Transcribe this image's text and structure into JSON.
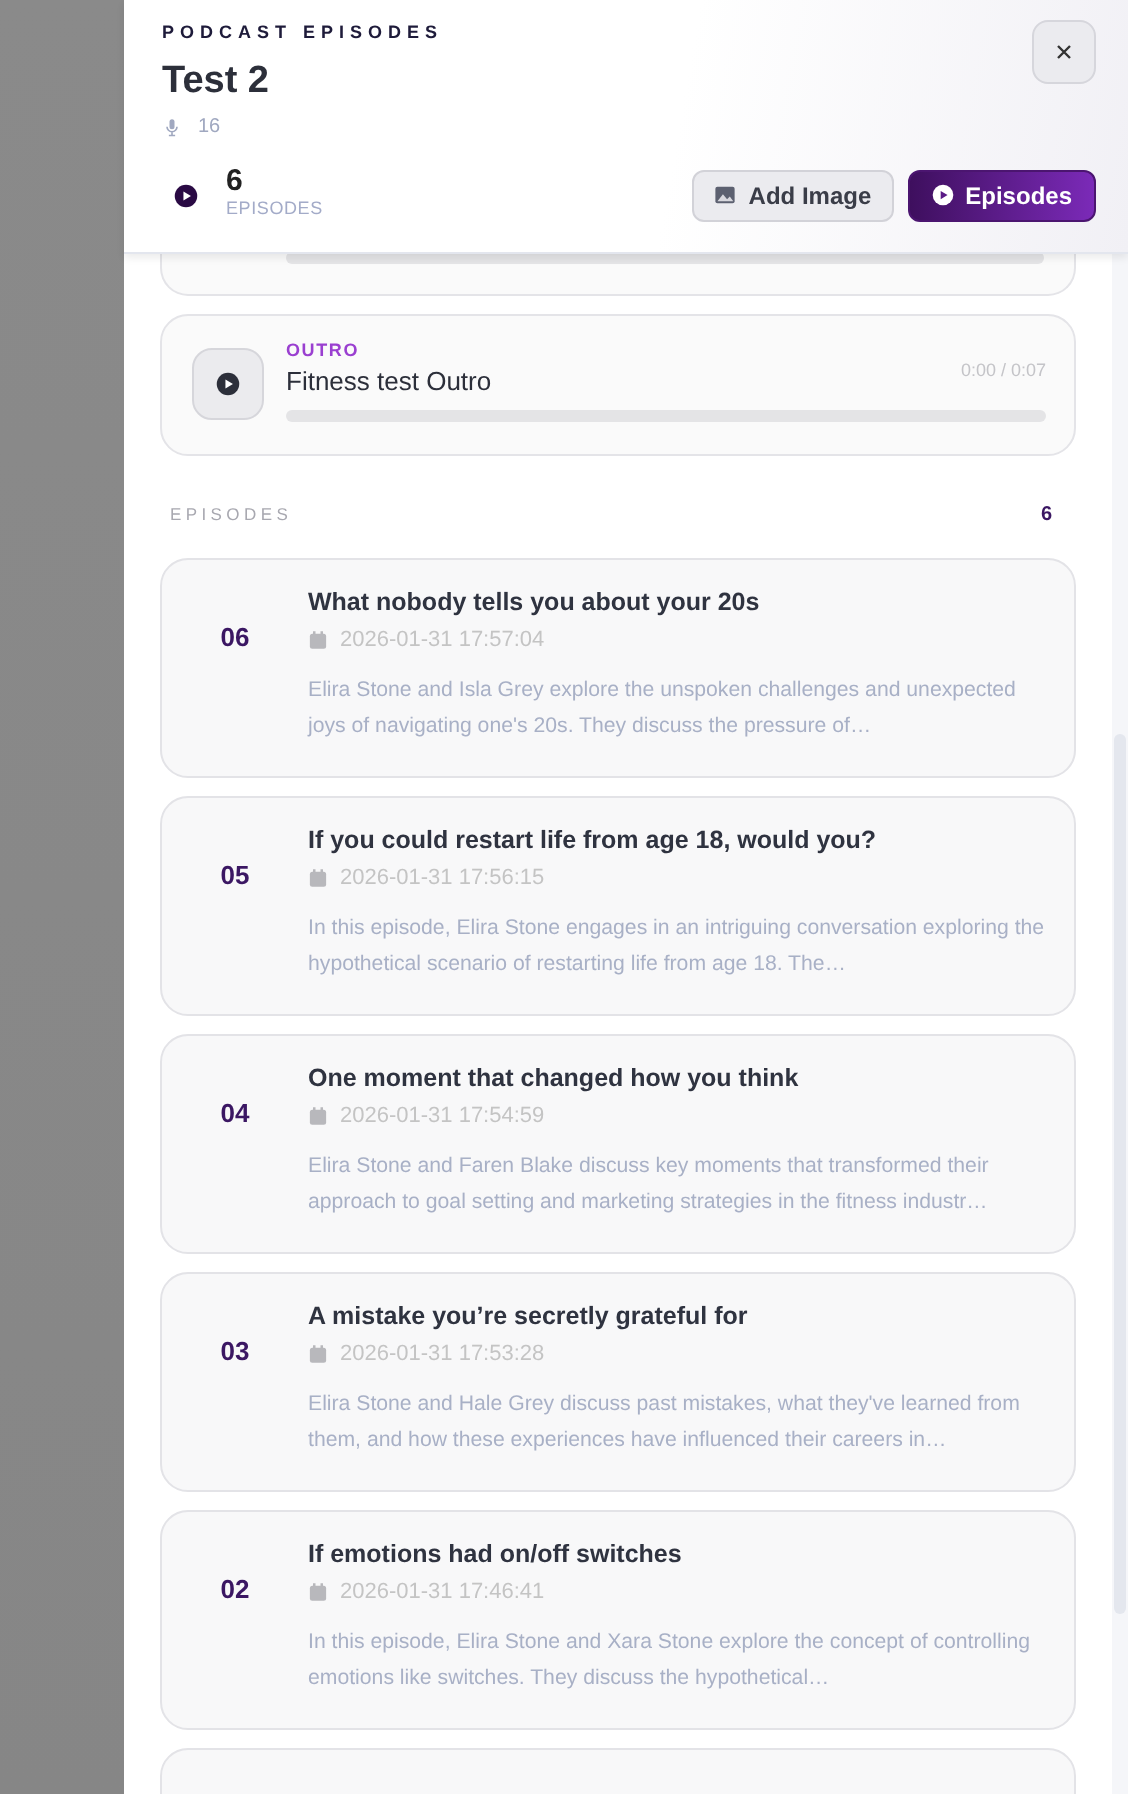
{
  "header": {
    "eyebrow": "PODCAST EPISODES",
    "title": "Test 2",
    "mic_count": "16",
    "episode_count": "6",
    "episode_count_label": "EPISODES",
    "buttons": [
      {
        "label": "Add Image",
        "kind": "secondary"
      },
      {
        "label": "Episodes",
        "kind": "primary"
      }
    ]
  },
  "players": [
    {
      "tag": "OUTRO",
      "title": "Fitness test Outro",
      "time": "0:00 / 0:07",
      "level": 0
    }
  ],
  "episodes_section": {
    "heading": "EPISODES",
    "count": "6"
  },
  "episodes": [
    {
      "number": "06",
      "title": "What nobody tells you about your 20s",
      "date": "2026-01-31 17:57:04",
      "description": "Elira Stone and Isla Grey explore the unspoken challenges and unexpected joys of navigating one's 20s. They discuss the pressure of…"
    },
    {
      "number": "05",
      "title": "If you could restart life from age 18, would you?",
      "date": "2026-01-31 17:56:15",
      "description": "In this episode, Elira Stone engages in an intriguing conversation exploring the hypothetical scenario of restarting life from age 18. The…"
    },
    {
      "number": "04",
      "title": "One moment that changed how you think",
      "date": "2026-01-31 17:54:59",
      "description": "Elira Stone and Faren Blake discuss key moments that transformed their approach to goal setting and marketing strategies in the fitness industr…"
    },
    {
      "number": "03",
      "title": "A mistake you’re secretly grateful for",
      "date": "2026-01-31 17:53:28",
      "description": "Elira Stone and Hale Grey discuss past mistakes, what they've learned from them, and how these experiences have influenced their careers in…"
    },
    {
      "number": "02",
      "title": "If emotions had on/off switches",
      "date": "2026-01-31 17:46:41",
      "description": "In this episode, Elira Stone and Xara Stone explore the concept of controlling emotions like switches. They discuss the hypothetical…"
    }
  ]
}
